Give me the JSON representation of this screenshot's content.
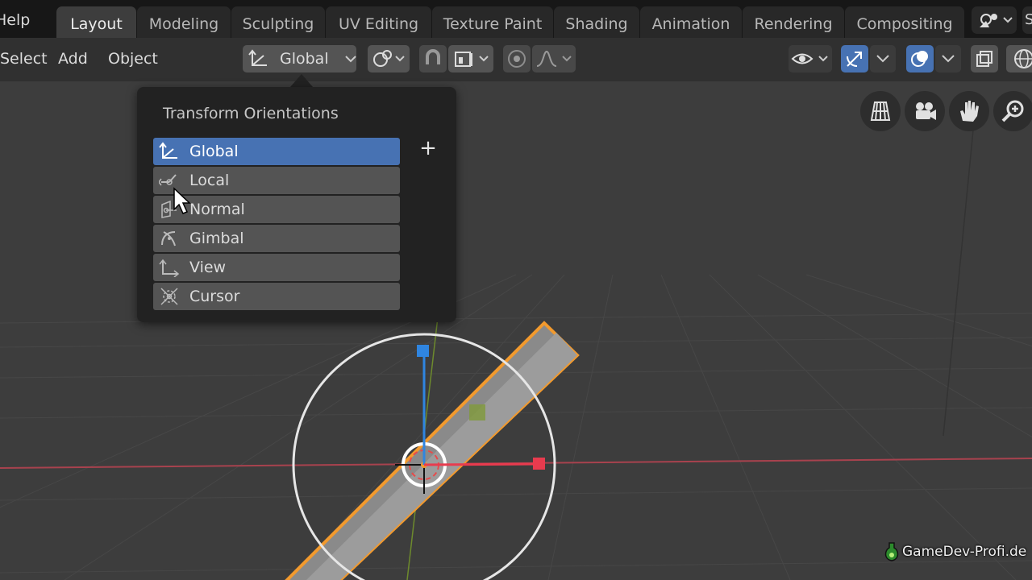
{
  "topbar": {
    "help_menu": "Help",
    "tabs": [
      {
        "label": "Layout",
        "active": true
      },
      {
        "label": "Modeling",
        "active": false
      },
      {
        "label": "Sculpting",
        "active": false
      },
      {
        "label": "UV Editing",
        "active": false
      },
      {
        "label": "Texture Paint",
        "active": false
      },
      {
        "label": "Shading",
        "active": false
      },
      {
        "label": "Animation",
        "active": false
      },
      {
        "label": "Rendering",
        "active": false
      },
      {
        "label": "Compositing",
        "active": false
      }
    ],
    "scene_icon": "scene-icon",
    "edge_label": "S"
  },
  "header": {
    "menus": {
      "select": "Select",
      "add": "Add",
      "object": "Object"
    },
    "orientation_dropdown": {
      "value": "Global",
      "icon": "transform-global-icon"
    },
    "pivot_icon": "pivot-link-icon",
    "snap_icon": "magnet-icon",
    "snap_target_icon": "snap-target-icon",
    "proportional_icon": "proportional-edit-icon",
    "falloff_icon": "falloff-curve-icon",
    "visibility_icon": "eye-icon",
    "gizmo_icon": "gizmo-icon",
    "overlay_icon": "overlay-icon",
    "xray_icon": "xray-icon",
    "shading_icon": "wireframe-sphere-icon"
  },
  "nav_gizmos": [
    "grid-view-icon",
    "camera-icon",
    "hand-pan-icon",
    "zoom-icon"
  ],
  "orientation_popup": {
    "title": "Transform Orientations",
    "add_label": "+",
    "items": [
      {
        "label": "Global",
        "icon": "global-axes-icon",
        "active": true
      },
      {
        "label": "Local",
        "icon": "local-axes-icon",
        "active": false
      },
      {
        "label": "Normal",
        "icon": "normal-icon",
        "active": false
      },
      {
        "label": "Gimbal",
        "icon": "gimbal-icon",
        "active": false
      },
      {
        "label": "View",
        "icon": "view-axes-icon",
        "active": false
      },
      {
        "label": "Cursor",
        "icon": "cursor-target-icon",
        "active": false
      }
    ]
  },
  "watermark": "GameDev-Profi.de",
  "colors": {
    "accent_blue": "#4772b3",
    "axis_x": "#e83b4e",
    "axis_z": "#2f85e0",
    "selection_orange": "#f29a2e"
  }
}
